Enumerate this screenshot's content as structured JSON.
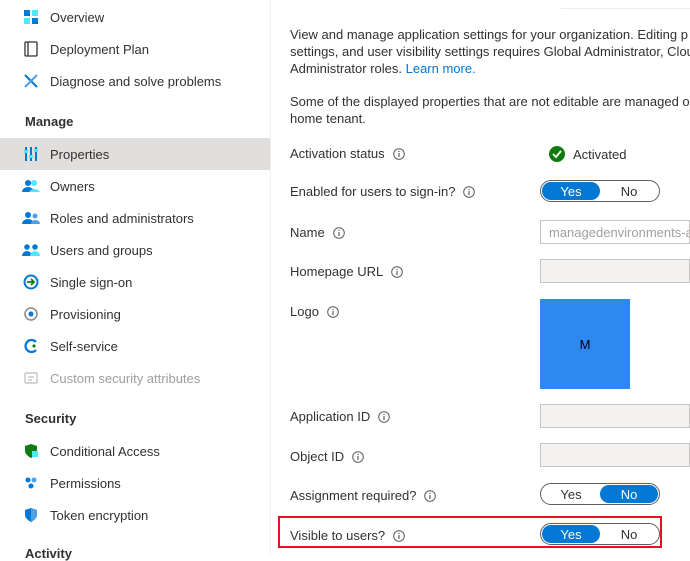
{
  "sidebar": {
    "items_top": [
      {
        "label": "Overview",
        "icon": "overview-grid-icon"
      },
      {
        "label": "Deployment Plan",
        "icon": "book-icon"
      },
      {
        "label": "Diagnose and solve problems",
        "icon": "wrench-icon"
      }
    ],
    "manage_heading": "Manage",
    "manage_items": [
      {
        "label": "Properties",
        "icon": "properties-sliders-icon",
        "active": true
      },
      {
        "label": "Owners",
        "icon": "owners-people-icon"
      },
      {
        "label": "Roles and administrators",
        "icon": "roles-people-icon"
      },
      {
        "label": "Users and groups",
        "icon": "users-groups-icon"
      },
      {
        "label": "Single sign-on",
        "icon": "sign-in-arrow-icon"
      },
      {
        "label": "Provisioning",
        "icon": "provisioning-cloud-icon"
      },
      {
        "label": "Self-service",
        "icon": "self-service-icon"
      },
      {
        "label": "Custom security attributes",
        "icon": "custom-attributes-icon",
        "disabled": true
      }
    ],
    "security_heading": "Security",
    "security_items": [
      {
        "label": "Conditional Access",
        "icon": "conditional-access-shield-icon"
      },
      {
        "label": "Permissions",
        "icon": "permissions-icon"
      },
      {
        "label": "Token encryption",
        "icon": "token-shield-icon"
      }
    ],
    "activity_heading": "Activity"
  },
  "main": {
    "intro_line1": "View and manage application settings for your organization. Editing p",
    "intro_line2": "settings, and user visibility settings requires Global Administrator, Clou",
    "intro_line3": "Administrator roles.",
    "learn_more": "Learn more.",
    "note_line1": "Some of the displayed properties that are not editable are managed o",
    "note_line2": "home tenant.",
    "fields": {
      "activation_status": {
        "label": "Activation status",
        "value": "Activated"
      },
      "enabled_sign_in": {
        "label": "Enabled for users to sign-in?",
        "yes": "Yes",
        "no": "No",
        "selected": "Yes"
      },
      "name": {
        "label": "Name",
        "value": "managedenvironments-a"
      },
      "homepage_url": {
        "label": "Homepage URL",
        "value": ""
      },
      "logo": {
        "label": "Logo",
        "initial": "M"
      },
      "application_id": {
        "label": "Application ID",
        "value": ""
      },
      "object_id": {
        "label": "Object ID",
        "value": ""
      },
      "assignment_required": {
        "label": "Assignment required?",
        "yes": "Yes",
        "no": "No",
        "selected": "No"
      },
      "visible_to_users": {
        "label": "Visible to users?",
        "yes": "Yes",
        "no": "No",
        "selected": "Yes"
      }
    }
  },
  "colors": {
    "accent": "#0078d4",
    "highlight": "#e81123",
    "success": "#107c10"
  }
}
